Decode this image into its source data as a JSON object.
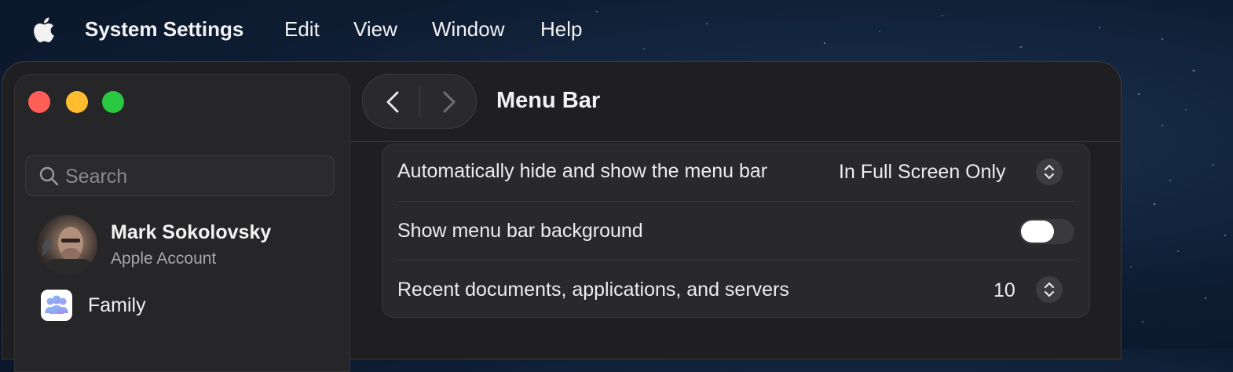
{
  "menubar": {
    "app_name": "System Settings",
    "items": [
      "Edit",
      "View",
      "Window",
      "Help"
    ]
  },
  "sidebar": {
    "search": {
      "placeholder": "Search",
      "value": ""
    },
    "account": {
      "name": "Mark Sokolovsky",
      "subtitle": "Apple Account"
    },
    "items": [
      {
        "label": "Family",
        "icon": "family-icon"
      }
    ]
  },
  "toolbar": {
    "title": "Menu Bar"
  },
  "settings": {
    "auto_hide": {
      "label": "Automatically hide and show the menu bar",
      "value": "In Full Screen Only"
    },
    "background": {
      "label": "Show menu bar background",
      "enabled": true
    },
    "recent": {
      "label": "Recent documents, applications, and servers",
      "value": "10"
    }
  },
  "colors": {
    "close": "#ff5f57",
    "minimize": "#febc2e",
    "zoom": "#28c840",
    "window_bg": "#1f1f21",
    "sidebar_bg": "#262628"
  }
}
